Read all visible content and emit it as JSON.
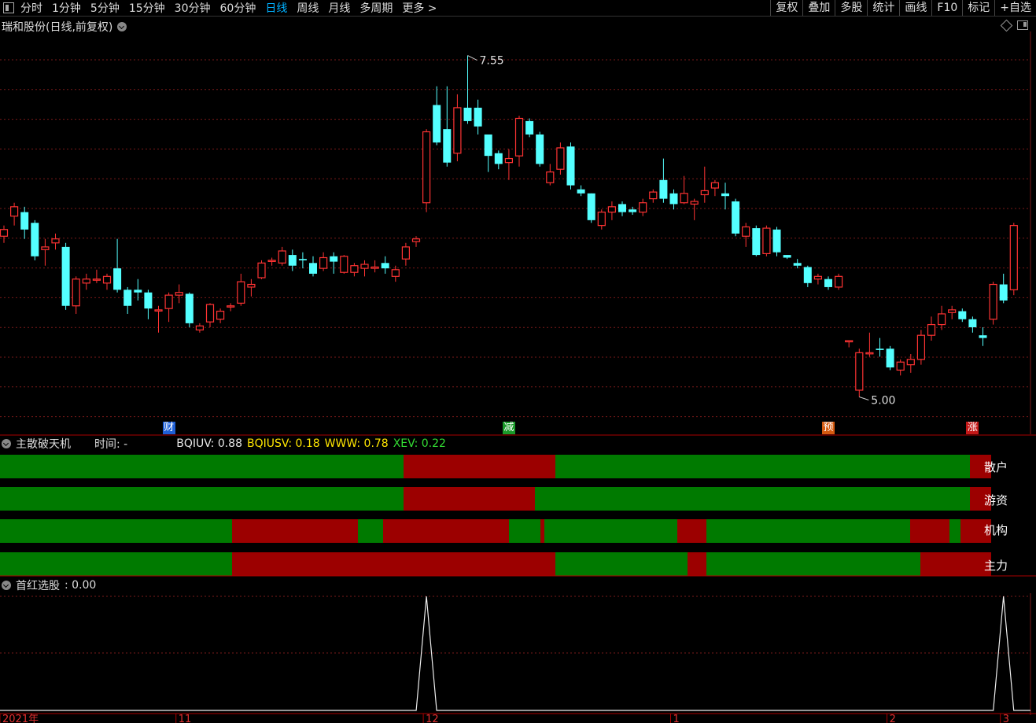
{
  "toolbar": {
    "periods": [
      "分时",
      "1分钟",
      "5分钟",
      "15分钟",
      "30分钟",
      "60分钟",
      "日线",
      "周线",
      "月线",
      "多周期",
      "更多 >"
    ],
    "active": "日线",
    "buttons": [
      "复权",
      "叠加",
      "多股",
      "统计",
      "画线",
      "F10",
      "标记",
      "+自选"
    ]
  },
  "main_chart": {
    "title": "瑞和股份(日线,前复权)",
    "high_label": "7.55",
    "low_label": "5.00",
    "event_markers": [
      {
        "text": "财",
        "color": "#1e5fd6",
        "index": 16
      },
      {
        "text": "减",
        "color": "#1a9a2a",
        "index": 49
      },
      {
        "text": "预",
        "color": "#d55a10",
        "index": 80
      },
      {
        "text": "涨",
        "color": "#c41818",
        "index": 94
      }
    ],
    "colors": {
      "up": "#ff3333",
      "down": "#54ffff",
      "grid": "#7a1a1a"
    }
  },
  "chart_data": {
    "type": "candlestick",
    "ylim": [
      4.85,
      7.7
    ],
    "ohlc": [
      [
        6.2,
        6.28,
        6.15,
        6.25
      ],
      [
        6.35,
        6.45,
        6.28,
        6.42
      ],
      [
        6.38,
        6.42,
        6.18,
        6.25
      ],
      [
        6.3,
        6.32,
        6.02,
        6.05
      ],
      [
        6.1,
        6.18,
        5.98,
        6.12
      ],
      [
        6.15,
        6.22,
        6.1,
        6.18
      ],
      [
        6.12,
        6.15,
        5.65,
        5.68
      ],
      [
        5.68,
        5.9,
        5.62,
        5.88
      ],
      [
        5.85,
        5.92,
        5.8,
        5.88
      ],
      [
        5.88,
        5.95,
        5.85,
        5.88
      ],
      [
        5.85,
        5.92,
        5.8,
        5.9
      ],
      [
        5.96,
        6.18,
        5.78,
        5.8
      ],
      [
        5.8,
        5.82,
        5.62,
        5.68
      ],
      [
        5.8,
        5.88,
        5.72,
        5.78
      ],
      [
        5.78,
        5.8,
        5.58,
        5.66
      ],
      [
        5.65,
        5.68,
        5.48,
        5.65
      ],
      [
        5.66,
        5.78,
        5.56,
        5.76
      ],
      [
        5.76,
        5.84,
        5.7,
        5.78
      ],
      [
        5.77,
        5.78,
        5.52,
        5.55
      ],
      [
        5.5,
        5.55,
        5.48,
        5.53
      ],
      [
        5.56,
        5.7,
        5.52,
        5.69
      ],
      [
        5.58,
        5.66,
        5.55,
        5.64
      ],
      [
        5.68,
        5.7,
        5.64,
        5.68
      ],
      [
        5.7,
        5.92,
        5.68,
        5.86
      ],
      [
        5.82,
        5.88,
        5.75,
        5.84
      ],
      [
        5.89,
        6.02,
        5.88,
        6.0
      ],
      [
        6.02,
        6.04,
        5.98,
        6.02
      ],
      [
        6.0,
        6.12,
        5.98,
        6.09
      ],
      [
        6.06,
        6.1,
        5.94,
        5.98
      ],
      [
        6.03,
        6.08,
        5.96,
        6.02
      ],
      [
        6.0,
        6.05,
        5.9,
        5.92
      ],
      [
        5.96,
        6.08,
        5.94,
        6.04
      ],
      [
        6.05,
        6.08,
        5.92,
        6.01
      ],
      [
        5.93,
        6.06,
        5.92,
        6.05
      ],
      [
        5.93,
        6.0,
        5.9,
        5.98
      ],
      [
        5.96,
        6.02,
        5.9,
        5.99
      ],
      [
        5.96,
        6.02,
        5.93,
        5.97
      ],
      [
        6.0,
        6.05,
        5.92,
        5.96
      ],
      [
        5.9,
        5.98,
        5.86,
        5.95
      ],
      [
        6.03,
        6.15,
        5.98,
        6.12
      ],
      [
        6.16,
        6.2,
        6.12,
        6.18
      ],
      [
        6.45,
        7.0,
        6.38,
        6.98
      ],
      [
        7.18,
        7.32,
        6.88,
        6.9
      ],
      [
        7.0,
        7.32,
        6.72,
        6.75
      ],
      [
        6.82,
        7.26,
        6.76,
        7.16
      ],
      [
        7.16,
        7.55,
        7.04,
        7.06
      ],
      [
        7.16,
        7.22,
        6.96,
        7.02
      ],
      [
        6.96,
        6.95,
        6.68,
        6.8
      ],
      [
        6.82,
        6.84,
        6.7,
        6.74
      ],
      [
        6.75,
        6.85,
        6.62,
        6.78
      ],
      [
        6.8,
        7.1,
        6.72,
        7.08
      ],
      [
        7.06,
        7.08,
        6.94,
        6.96
      ],
      [
        6.96,
        6.98,
        6.72,
        6.74
      ],
      [
        6.6,
        6.74,
        6.58,
        6.68
      ],
      [
        6.7,
        6.9,
        6.66,
        6.86
      ],
      [
        6.87,
        6.9,
        6.55,
        6.58
      ],
      [
        6.55,
        6.58,
        6.5,
        6.52
      ],
      [
        6.52,
        6.52,
        6.3,
        6.32
      ],
      [
        6.28,
        6.4,
        6.25,
        6.38
      ],
      [
        6.38,
        6.46,
        6.32,
        6.42
      ],
      [
        6.44,
        6.46,
        6.35,
        6.38
      ],
      [
        6.4,
        6.42,
        6.36,
        6.38
      ],
      [
        6.38,
        6.48,
        6.35,
        6.45
      ],
      [
        6.48,
        6.55,
        6.45,
        6.53
      ],
      [
        6.62,
        6.78,
        6.45,
        6.48
      ],
      [
        6.52,
        6.55,
        6.4,
        6.44
      ],
      [
        6.45,
        6.65,
        6.44,
        6.52
      ],
      [
        6.44,
        6.48,
        6.32,
        6.46
      ],
      [
        6.51,
        6.72,
        6.45,
        6.54
      ],
      [
        6.56,
        6.62,
        6.5,
        6.6
      ],
      [
        6.52,
        6.6,
        6.4,
        6.5
      ],
      [
        6.46,
        6.48,
        6.2,
        6.22
      ],
      [
        6.2,
        6.3,
        6.12,
        6.27
      ],
      [
        6.26,
        6.28,
        6.05,
        6.06
      ],
      [
        6.07,
        6.28,
        6.05,
        6.26
      ],
      [
        6.25,
        6.27,
        6.05,
        6.08
      ],
      [
        6.06,
        6.06,
        6.03,
        6.04
      ],
      [
        6.0,
        6.03,
        5.96,
        5.98
      ],
      [
        5.97,
        5.98,
        5.82,
        5.85
      ],
      [
        5.88,
        5.92,
        5.84,
        5.9
      ],
      [
        5.88,
        5.9,
        5.8,
        5.82
      ],
      [
        5.82,
        5.92,
        5.8,
        5.9
      ],
      [
        5.42,
        5.41,
        5.37,
        5.42
      ],
      [
        5.05,
        5.36,
        5.0,
        5.33
      ],
      [
        5.33,
        5.48,
        5.3,
        5.33
      ],
      [
        5.36,
        5.44,
        5.3,
        5.35
      ],
      [
        5.36,
        5.38,
        5.2,
        5.22
      ],
      [
        5.2,
        5.28,
        5.16,
        5.26
      ],
      [
        5.24,
        5.32,
        5.18,
        5.28
      ],
      [
        5.28,
        5.5,
        5.24,
        5.46
      ],
      [
        5.46,
        5.6,
        5.42,
        5.54
      ],
      [
        5.54,
        5.68,
        5.5,
        5.62
      ],
      [
        5.63,
        5.68,
        5.58,
        5.65
      ],
      [
        5.64,
        5.66,
        5.56,
        5.58
      ],
      [
        5.58,
        5.6,
        5.48,
        5.52
      ],
      [
        5.46,
        5.52,
        5.38,
        5.44
      ],
      [
        5.58,
        5.86,
        5.54,
        5.84
      ],
      [
        5.84,
        5.92,
        5.7,
        5.72
      ],
      [
        5.8,
        6.3,
        5.76,
        6.28
      ]
    ]
  },
  "indicator1": {
    "title": "主散破天机",
    "time_label": "时间: -",
    "values": [
      {
        "text": "BQIUV: 0.88",
        "color": "#e8e8e8"
      },
      {
        "text": "BQIUSV: 0.18",
        "color": "#ffe600"
      },
      {
        "text": "WWW: 0.78",
        "color": "#ffe600"
      },
      {
        "text": "XEV: 0.22",
        "color": "#33dd33"
      }
    ],
    "green": "#007a00",
    "red": "#9c0000",
    "bands": [
      {
        "label": "散户",
        "segments": [
          [
            "g",
            0,
            513
          ],
          [
            "r",
            513,
            706
          ],
          [
            "g",
            706,
            1233
          ],
          [
            "r",
            1233,
            1260
          ]
        ]
      },
      {
        "label": "游资",
        "segments": [
          [
            "g",
            0,
            513
          ],
          [
            "r",
            513,
            680
          ],
          [
            "g",
            680,
            1233
          ],
          [
            "r",
            1233,
            1260
          ]
        ]
      },
      {
        "label": "机构",
        "segments": [
          [
            "g",
            0,
            295
          ],
          [
            "r",
            295,
            455
          ],
          [
            "g",
            455,
            487
          ],
          [
            "r",
            487,
            647
          ],
          [
            "g",
            647,
            687
          ],
          [
            "r",
            687,
            692
          ],
          [
            "g",
            692,
            861
          ],
          [
            "r",
            861,
            898
          ],
          [
            "g",
            898,
            1157
          ],
          [
            "r",
            1157,
            1207
          ],
          [
            "g",
            1207,
            1221
          ],
          [
            "r",
            1221,
            1260
          ]
        ]
      },
      {
        "label": "主力",
        "segments": [
          [
            "g",
            0,
            295
          ],
          [
            "r",
            295,
            706
          ],
          [
            "g",
            706,
            874
          ],
          [
            "r",
            874,
            898
          ],
          [
            "g",
            898,
            1170
          ],
          [
            "r",
            1170,
            1260
          ]
        ]
      }
    ]
  },
  "indicator2": {
    "title": "首红选股",
    "value_text": ": 0.00",
    "spikes_at_index": [
      41,
      97
    ]
  },
  "date_axis": {
    "labels": [
      "2021年",
      "11",
      "12",
      "1",
      "2",
      "3"
    ],
    "label_index": [
      0,
      17,
      41,
      65,
      86,
      97
    ]
  }
}
